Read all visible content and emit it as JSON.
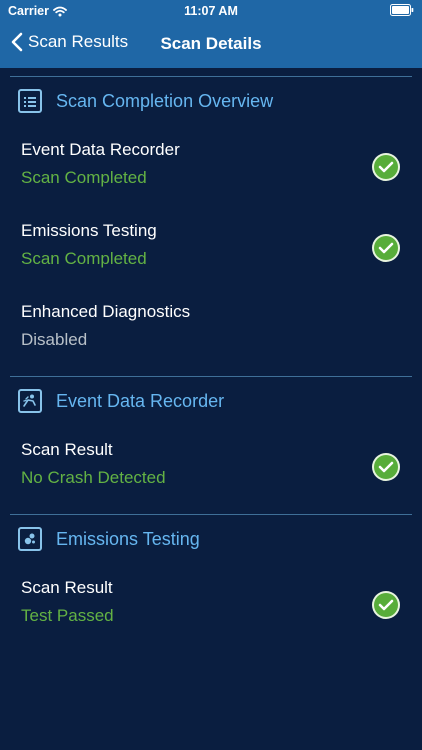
{
  "status_bar": {
    "carrier": "Carrier",
    "time": "11:07 AM"
  },
  "nav": {
    "back_label": "Scan Results",
    "title": "Scan Details"
  },
  "sections": [
    {
      "title": "Scan Completion Overview",
      "icon": "list-icon",
      "items": [
        {
          "label": "Event Data Recorder",
          "status": "Scan Completed",
          "status_color": "#63b244"
        },
        {
          "label": "Emissions Testing",
          "status": "Scan Completed",
          "status_color": "#63b244"
        },
        {
          "label": "Enhanced Diagnostics",
          "status": "Disabled",
          "status_color": "#b8c0c8"
        }
      ]
    },
    {
      "title": "Event Data Recorder",
      "icon": "airbag-icon",
      "items": [
        {
          "label": "Scan Result",
          "status": "No Crash Detected",
          "status_color": "#63b244"
        }
      ]
    },
    {
      "title": "Emissions Testing",
      "icon": "emissions-icon",
      "items": [
        {
          "label": "Scan Result",
          "status": "Test Passed",
          "status_color": "#63b244"
        }
      ]
    }
  ],
  "colors": {
    "background": "#0a1e40",
    "nav_bar": "#1f67a6",
    "section_title": "#66b6f0",
    "success": "#63b244"
  }
}
